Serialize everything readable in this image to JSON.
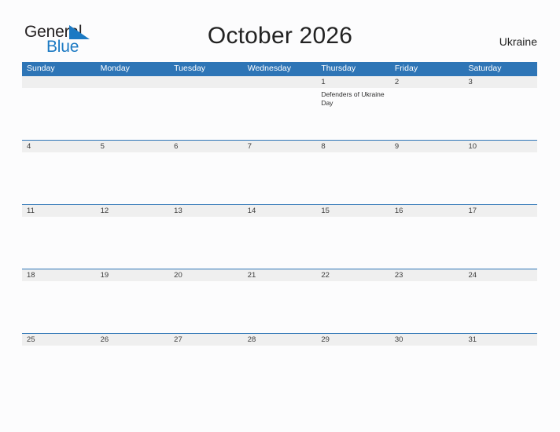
{
  "brand": {
    "name_part1": "General",
    "name_part2": "Blue",
    "flag_icon": "blue-triangle-flag",
    "flag_color": "#1b79c3"
  },
  "header": {
    "title": "October 2026",
    "country": "Ukraine"
  },
  "colors": {
    "header_band": "#2e75b6",
    "date_band": "#efefef",
    "page_background": "#fcfcfd",
    "text": "#222222",
    "brand_blue": "#1b79c3"
  },
  "calendar": {
    "month": "October",
    "year": "2026",
    "day_headers": [
      "Sunday",
      "Monday",
      "Tuesday",
      "Wednesday",
      "Thursday",
      "Friday",
      "Saturday"
    ],
    "weeks": [
      [
        {
          "date": "",
          "event": ""
        },
        {
          "date": "",
          "event": ""
        },
        {
          "date": "",
          "event": ""
        },
        {
          "date": "",
          "event": ""
        },
        {
          "date": "1",
          "event": "Defenders of Ukraine Day"
        },
        {
          "date": "2",
          "event": ""
        },
        {
          "date": "3",
          "event": ""
        }
      ],
      [
        {
          "date": "4",
          "event": ""
        },
        {
          "date": "5",
          "event": ""
        },
        {
          "date": "6",
          "event": ""
        },
        {
          "date": "7",
          "event": ""
        },
        {
          "date": "8",
          "event": ""
        },
        {
          "date": "9",
          "event": ""
        },
        {
          "date": "10",
          "event": ""
        }
      ],
      [
        {
          "date": "11",
          "event": ""
        },
        {
          "date": "12",
          "event": ""
        },
        {
          "date": "13",
          "event": ""
        },
        {
          "date": "14",
          "event": ""
        },
        {
          "date": "15",
          "event": ""
        },
        {
          "date": "16",
          "event": ""
        },
        {
          "date": "17",
          "event": ""
        }
      ],
      [
        {
          "date": "18",
          "event": ""
        },
        {
          "date": "19",
          "event": ""
        },
        {
          "date": "20",
          "event": ""
        },
        {
          "date": "21",
          "event": ""
        },
        {
          "date": "22",
          "event": ""
        },
        {
          "date": "23",
          "event": ""
        },
        {
          "date": "24",
          "event": ""
        }
      ],
      [
        {
          "date": "25",
          "event": ""
        },
        {
          "date": "26",
          "event": ""
        },
        {
          "date": "27",
          "event": ""
        },
        {
          "date": "28",
          "event": ""
        },
        {
          "date": "29",
          "event": ""
        },
        {
          "date": "30",
          "event": ""
        },
        {
          "date": "31",
          "event": ""
        }
      ]
    ]
  }
}
